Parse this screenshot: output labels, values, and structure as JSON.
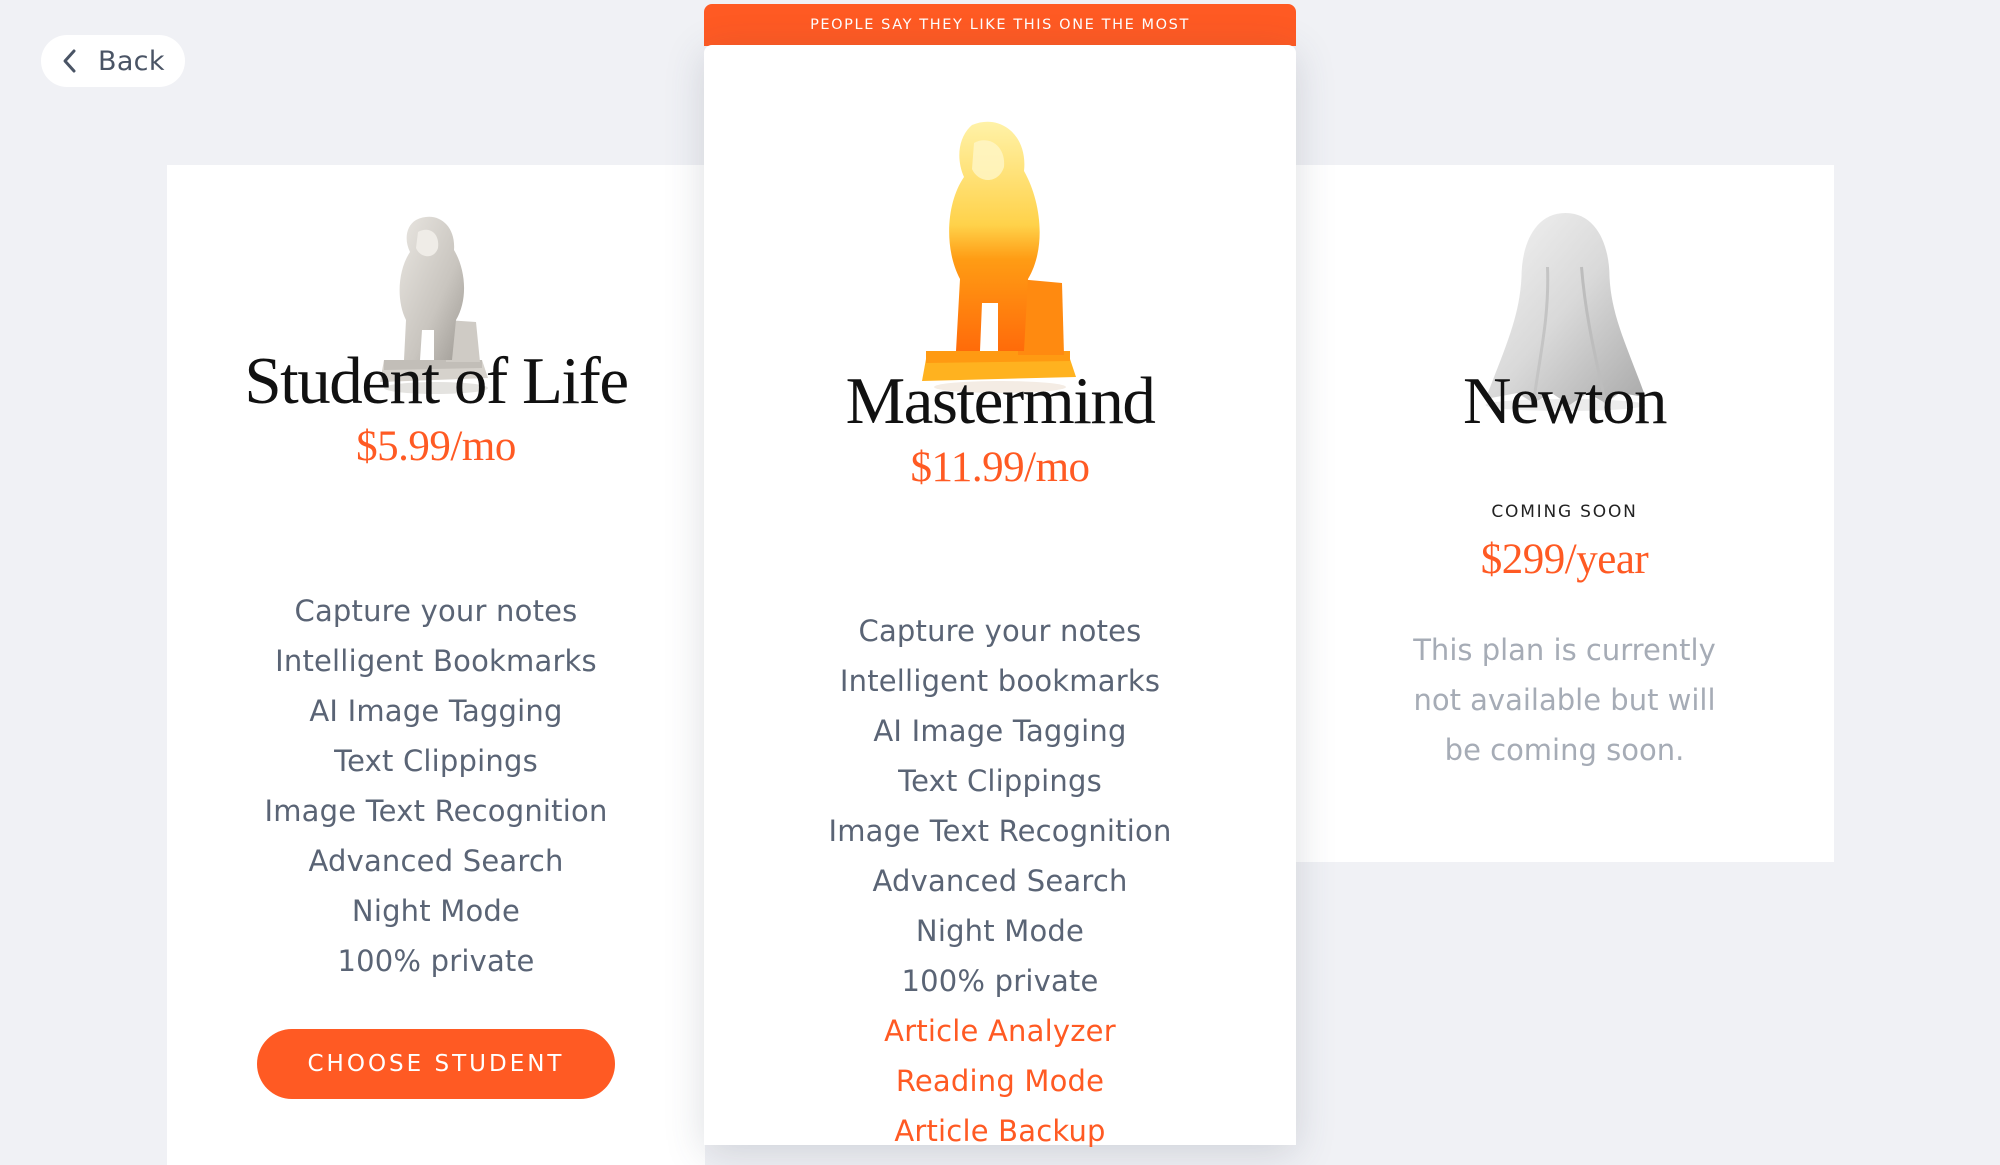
{
  "nav": {
    "back_label": "Back"
  },
  "banner": {
    "text": "PEOPLE SAY THEY LIKE THIS ONE THE MOST"
  },
  "plans": [
    {
      "name": "Student of Life",
      "price": "$5.99/mo",
      "features": [
        "Capture your notes",
        "Intelligent Bookmarks",
        "AI Image Tagging",
        "Text Clippings",
        "Image Text Recognition",
        "Advanced Search",
        "Night Mode",
        "100% private"
      ],
      "cta_label": "CHOOSE STUDENT"
    },
    {
      "name": "Mastermind",
      "price": "$11.99/mo",
      "features": [
        "Capture your notes",
        "Intelligent bookmarks",
        "AI Image Tagging",
        "Text Clippings",
        "Image Text Recognition",
        "Advanced Search",
        "Night Mode",
        "100% private"
      ],
      "extra_features": [
        "Article Analyzer",
        "Reading Mode",
        "Article Backup"
      ]
    },
    {
      "name": "Newton",
      "status": "COMING SOON",
      "price": "$299/year",
      "note": "This plan is currently not available but will be coming soon."
    }
  ],
  "colors": {
    "accent": "#ff5a23",
    "background": "#f0f1f5",
    "card": "#ffffff",
    "feature_text": "#5a6475",
    "muted_text": "#a6acb6"
  },
  "icons": {
    "back": "chevron-left-icon",
    "plan_student": "white-thinker-statue",
    "plan_mastermind": "golden-thinker-statue",
    "plan_newton": "ghost-sheet-figure"
  }
}
